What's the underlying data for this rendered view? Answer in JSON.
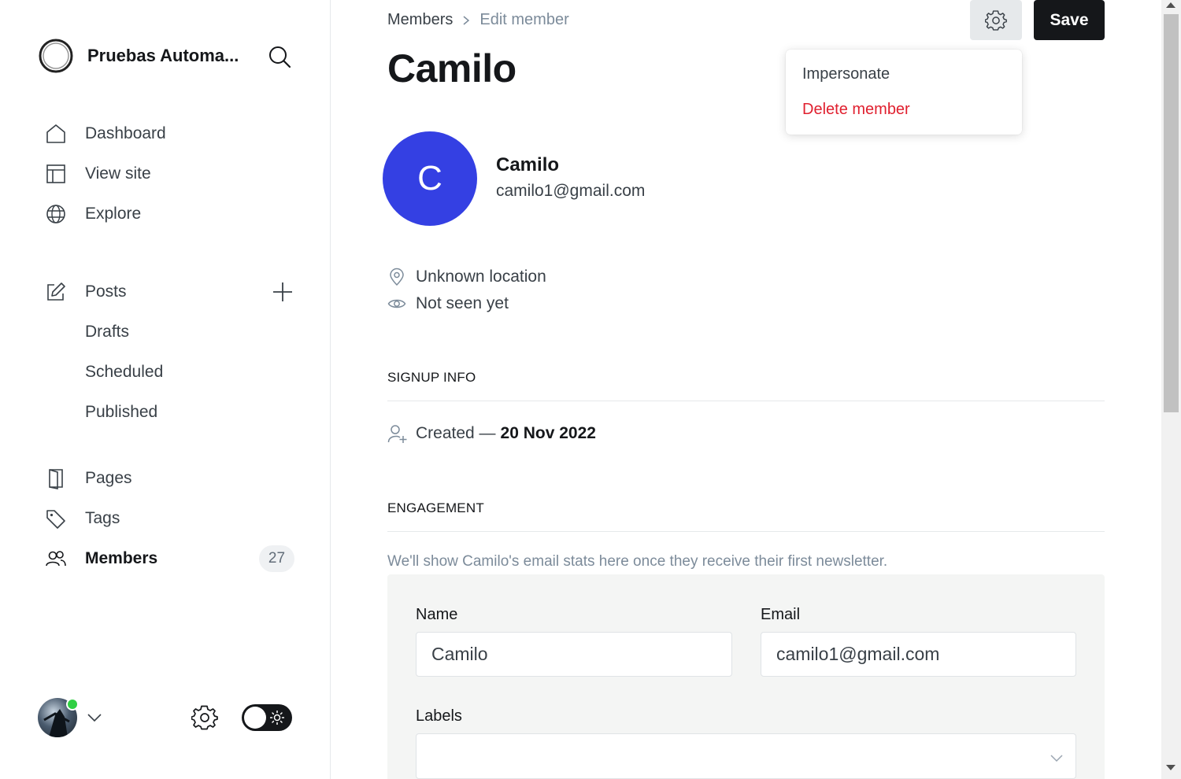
{
  "sidebar": {
    "brand_name": "Pruebas Automa...",
    "nav_primary": [
      {
        "label": "Dashboard",
        "icon": "home-icon"
      },
      {
        "label": "View site",
        "icon": "layout-icon"
      },
      {
        "label": "Explore",
        "icon": "globe-icon"
      }
    ],
    "posts": {
      "label": "Posts",
      "sub": [
        "Drafts",
        "Scheduled",
        "Published"
      ]
    },
    "nav_secondary": [
      {
        "label": "Pages",
        "icon": "page-icon"
      },
      {
        "label": "Tags",
        "icon": "tag-icon"
      },
      {
        "label": "Members",
        "icon": "members-icon",
        "count": "27",
        "active": true
      }
    ]
  },
  "header": {
    "breadcrumb_parent": "Members",
    "breadcrumb_current": "Edit member",
    "title": "Camilo",
    "save_label": "Save"
  },
  "settings_menu": {
    "impersonate": "Impersonate",
    "delete": "Delete member"
  },
  "member": {
    "initial": "C",
    "name": "Camilo",
    "email": "camilo1@gmail.com",
    "location": "Unknown location",
    "last_seen": "Not seen yet"
  },
  "signup": {
    "section_title": "SIGNUP INFO",
    "created_prefix": "Created —",
    "created_date": "20 Nov 2022"
  },
  "engagement": {
    "section_title": "ENGAGEMENT",
    "note": "We'll show Camilo's email stats here once they receive their first newsletter."
  },
  "form": {
    "name_label": "Name",
    "name_value": "Camilo",
    "email_label": "Email",
    "email_value": "camilo1@gmail.com",
    "labels_label": "Labels"
  },
  "colors": {
    "accent": "#3440e3",
    "danger": "#e0202f",
    "online": "#30cf43",
    "primary_button": "#15171a"
  }
}
